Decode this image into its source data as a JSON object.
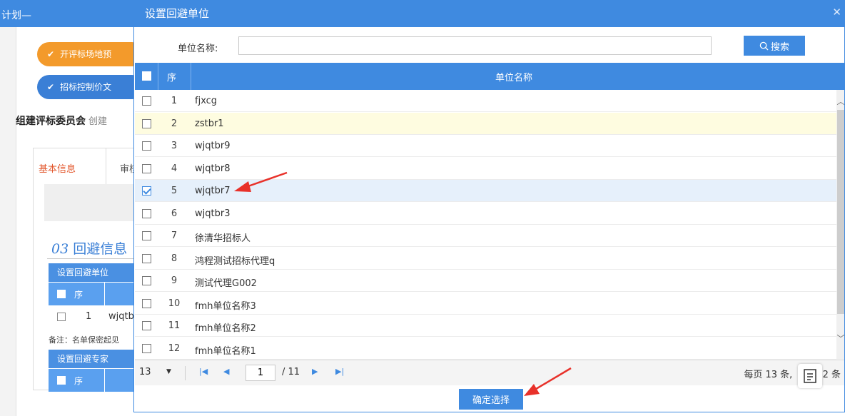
{
  "background": {
    "header_title": "计划—",
    "steps": [
      "开评标场地预",
      "招标控制价文"
    ],
    "section_title": "组建评标委员会",
    "section_sub": "创建",
    "tabs": [
      "基本信息",
      "审核"
    ],
    "section_03_num": "03",
    "section_03_label": "回避信息",
    "unit_bar": "设置回避单位",
    "expert_bar": "设置回避专家",
    "seq_header": "序",
    "row1_num": "1",
    "row1_name": "wjqtb",
    "note": "备注：名单保密起见"
  },
  "modal": {
    "title": "设置回避单位",
    "close_icon": "close-icon",
    "search": {
      "label": "单位名称:",
      "value": "",
      "placeholder": "",
      "button_label": "搜索"
    },
    "table": {
      "headers": {
        "seq": "序",
        "name": "单位名称"
      },
      "rows": [
        {
          "seq": "1",
          "name": "fjxcg",
          "checked": false
        },
        {
          "seq": "2",
          "name": "zstbr1",
          "checked": false
        },
        {
          "seq": "3",
          "name": "wjqtbr9",
          "checked": false
        },
        {
          "seq": "4",
          "name": "wjqtbr8",
          "checked": false
        },
        {
          "seq": "5",
          "name": "wjqtbr7",
          "checked": true
        },
        {
          "seq": "6",
          "name": "wjqtbr3",
          "checked": false
        },
        {
          "seq": "7",
          "name": "徐清华招标人",
          "checked": false
        },
        {
          "seq": "8",
          "name": "鸿程测试招标代理q",
          "checked": false
        },
        {
          "seq": "9",
          "name": "测试代理G002",
          "checked": false
        },
        {
          "seq": "10",
          "name": "fmh单位名称3",
          "checked": false
        },
        {
          "seq": "11",
          "name": "fmh单位名称2",
          "checked": false
        },
        {
          "seq": "12",
          "name": "fmh单位名称1",
          "checked": false
        }
      ]
    },
    "pager": {
      "page_size": "13",
      "current_page": "1",
      "total_pages": "/ 11",
      "info_prefix": "每页 13 条,",
      "info_suffix": "42 条"
    },
    "confirm_label": "确定选择"
  },
  "colors": {
    "primary": "#3f8ae0",
    "highlight_yellow": "#fefce0",
    "highlight_blue": "#e6f0fb",
    "arrow": "#e8312a"
  }
}
